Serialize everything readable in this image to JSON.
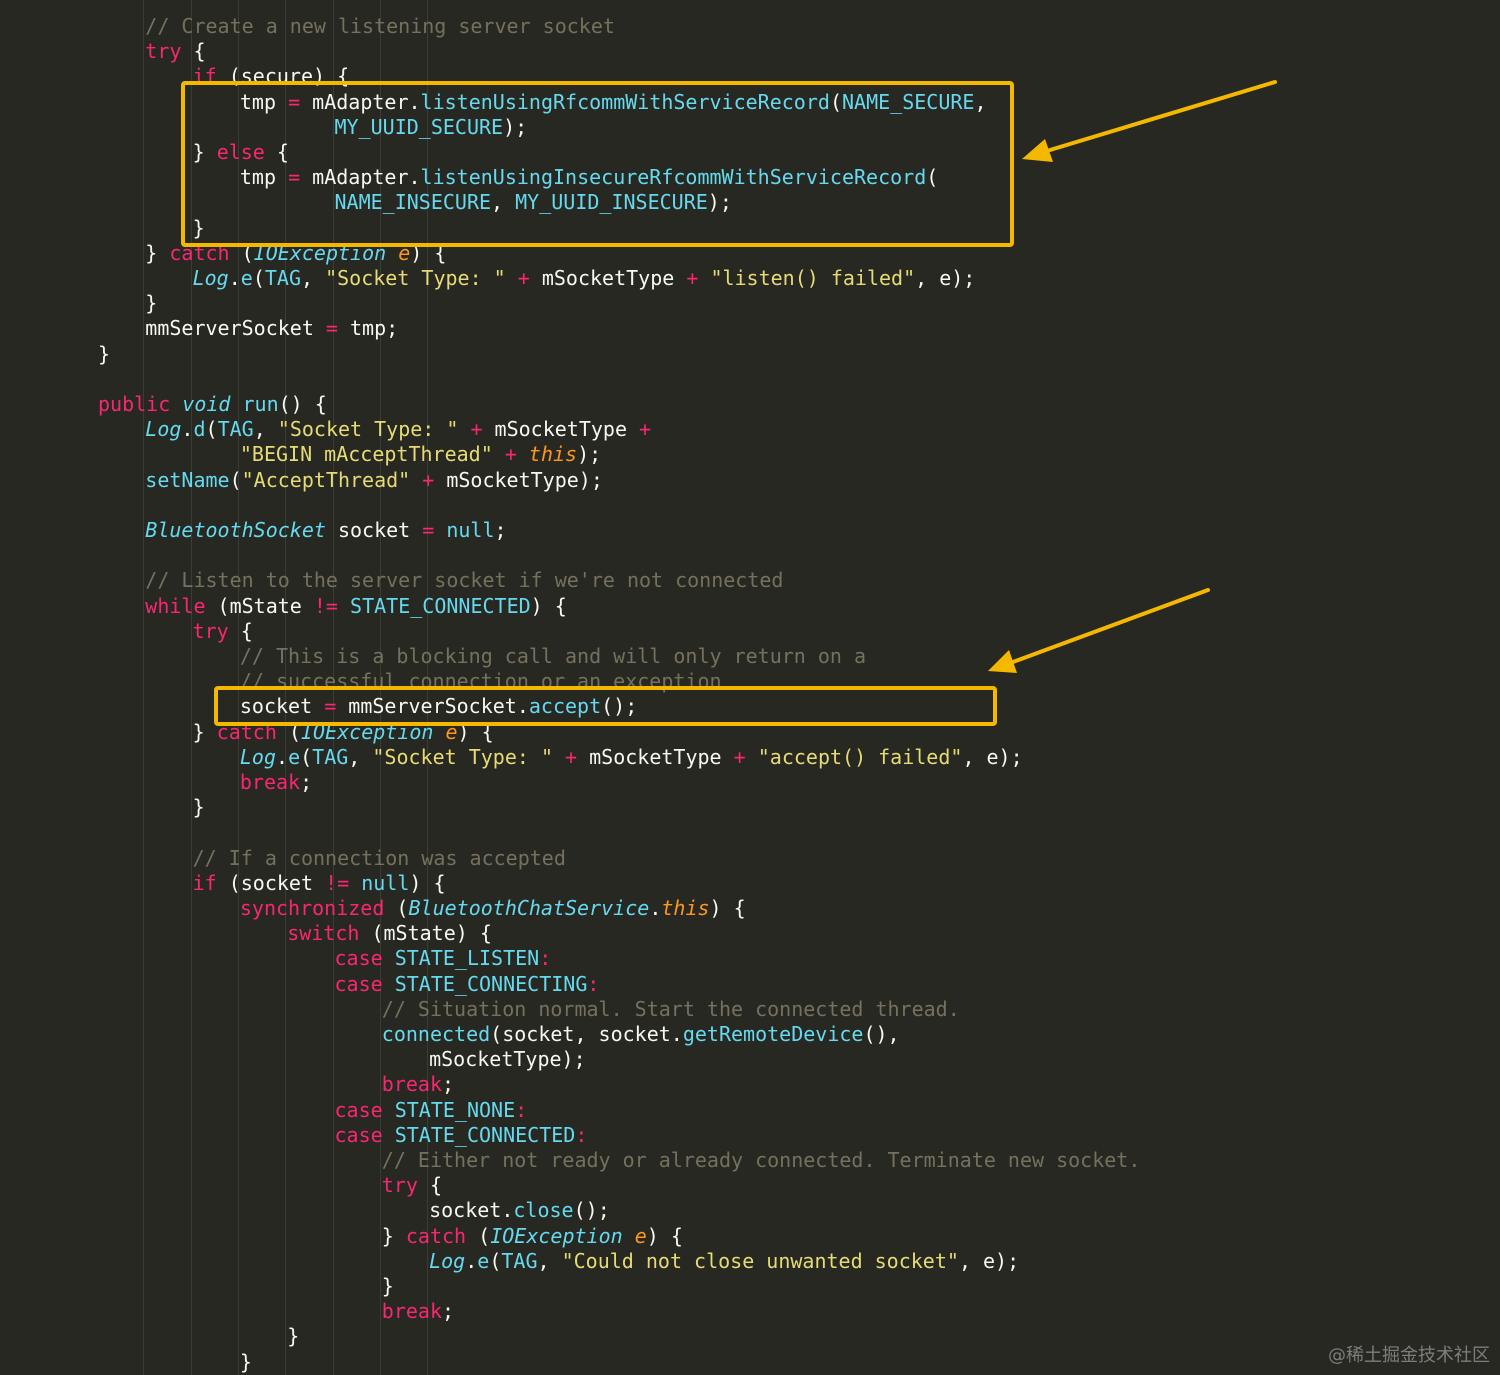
{
  "code_lines": [
    [
      [
        "cm",
        "// Create a new listening server socket"
      ]
    ],
    [
      [
        "kw",
        "try"
      ],
      [
        "p",
        " {"
      ]
    ],
    [
      [
        "kw",
        "if"
      ],
      [
        "p",
        " (secure) {"
      ]
    ],
    [
      [
        "p",
        "tmp "
      ],
      [
        "op",
        "="
      ],
      [
        "p",
        " mAdapter."
      ],
      [
        "fn",
        "listenUsingRfcommWithServiceRecord"
      ],
      [
        "p",
        "("
      ],
      [
        "cn",
        "NAME_SECURE"
      ],
      [
        "p",
        ","
      ]
    ],
    [
      [
        "cn",
        "MY_UUID_SECURE"
      ],
      [
        "p",
        ");"
      ]
    ],
    [
      [
        "p",
        "} "
      ],
      [
        "kw",
        "else"
      ],
      [
        "p",
        " {"
      ]
    ],
    [
      [
        "p",
        "tmp "
      ],
      [
        "op",
        "="
      ],
      [
        "p",
        " mAdapter."
      ],
      [
        "fn",
        "listenUsingInsecureRfcommWithServiceRecord"
      ],
      [
        "p",
        "("
      ]
    ],
    [
      [
        "cn",
        "NAME_INSECURE"
      ],
      [
        "p",
        ", "
      ],
      [
        "cn",
        "MY_UUID_INSECURE"
      ],
      [
        "p",
        ");"
      ]
    ],
    [
      [
        "p",
        "}"
      ]
    ],
    [
      [
        "p",
        "} "
      ],
      [
        "kw",
        "catch"
      ],
      [
        "p",
        " ("
      ],
      [
        "ty",
        "IOException"
      ],
      [
        "p",
        " "
      ],
      [
        "pa",
        "e"
      ],
      [
        "p",
        ") {"
      ]
    ],
    [
      [
        "ty",
        "Log"
      ],
      [
        "p",
        "."
      ],
      [
        "fn",
        "e"
      ],
      [
        "p",
        "("
      ],
      [
        "cn",
        "TAG"
      ],
      [
        "p",
        ", "
      ],
      [
        "st",
        "\"Socket Type: \""
      ],
      [
        "p",
        " "
      ],
      [
        "op",
        "+"
      ],
      [
        "p",
        " mSocketType "
      ],
      [
        "op",
        "+"
      ],
      [
        "p",
        " "
      ],
      [
        "st",
        "\"listen() failed\""
      ],
      [
        "p",
        ", e);"
      ]
    ],
    [
      [
        "p",
        "}"
      ]
    ],
    [
      [
        "p",
        "mmServerSocket "
      ],
      [
        "op",
        "="
      ],
      [
        "p",
        " tmp;"
      ]
    ],
    [
      [
        "p",
        "}"
      ]
    ],
    [],
    [
      [
        "kw",
        "public"
      ],
      [
        "p",
        " "
      ],
      [
        "ty",
        "void"
      ],
      [
        "p",
        " "
      ],
      [
        "fn",
        "run"
      ],
      [
        "p",
        "() {"
      ]
    ],
    [
      [
        "ty",
        "Log"
      ],
      [
        "p",
        "."
      ],
      [
        "fn",
        "d"
      ],
      [
        "p",
        "("
      ],
      [
        "cn",
        "TAG"
      ],
      [
        "p",
        ", "
      ],
      [
        "st",
        "\"Socket Type: \""
      ],
      [
        "p",
        " "
      ],
      [
        "op",
        "+"
      ],
      [
        "p",
        " mSocketType "
      ],
      [
        "op",
        "+"
      ]
    ],
    [
      [
        "st",
        "\"BEGIN mAcceptThread\""
      ],
      [
        "p",
        " "
      ],
      [
        "op",
        "+"
      ],
      [
        "p",
        " "
      ],
      [
        "th",
        "this"
      ],
      [
        "p",
        ");"
      ]
    ],
    [
      [
        "fn",
        "setName"
      ],
      [
        "p",
        "("
      ],
      [
        "st",
        "\"AcceptThread\""
      ],
      [
        "p",
        " "
      ],
      [
        "op",
        "+"
      ],
      [
        "p",
        " mSocketType);"
      ]
    ],
    [],
    [
      [
        "ty",
        "BluetoothSocket"
      ],
      [
        "p",
        " socket "
      ],
      [
        "op",
        "="
      ],
      [
        "p",
        " "
      ],
      [
        "cn",
        "null"
      ],
      [
        "p",
        ";"
      ]
    ],
    [],
    [
      [
        "cm",
        "// Listen to the server socket if we're not connected"
      ]
    ],
    [
      [
        "kw",
        "while"
      ],
      [
        "p",
        " (mState "
      ],
      [
        "op",
        "!="
      ],
      [
        "p",
        " "
      ],
      [
        "cn",
        "STATE_CONNECTED"
      ],
      [
        "p",
        ") {"
      ]
    ],
    [
      [
        "kw",
        "try"
      ],
      [
        "p",
        " {"
      ]
    ],
    [
      [
        "cm",
        "// This is a blocking call and will only return on a"
      ]
    ],
    [
      [
        "cm",
        "// successful connection or an exception"
      ]
    ],
    [
      [
        "p",
        "socket "
      ],
      [
        "op",
        "="
      ],
      [
        "p",
        " mmServerSocket."
      ],
      [
        "fn",
        "accept"
      ],
      [
        "p",
        "();"
      ]
    ],
    [
      [
        "p",
        "} "
      ],
      [
        "kw",
        "catch"
      ],
      [
        "p",
        " ("
      ],
      [
        "ty",
        "IOException"
      ],
      [
        "p",
        " "
      ],
      [
        "pa",
        "e"
      ],
      [
        "p",
        ") {"
      ]
    ],
    [
      [
        "ty",
        "Log"
      ],
      [
        "p",
        "."
      ],
      [
        "fn",
        "e"
      ],
      [
        "p",
        "("
      ],
      [
        "cn",
        "TAG"
      ],
      [
        "p",
        ", "
      ],
      [
        "st",
        "\"Socket Type: \""
      ],
      [
        "p",
        " "
      ],
      [
        "op",
        "+"
      ],
      [
        "p",
        " mSocketType "
      ],
      [
        "op",
        "+"
      ],
      [
        "p",
        " "
      ],
      [
        "st",
        "\"accept() failed\""
      ],
      [
        "p",
        ", e);"
      ]
    ],
    [
      [
        "kw",
        "break"
      ],
      [
        "p",
        ";"
      ]
    ],
    [
      [
        "p",
        "}"
      ]
    ],
    [],
    [
      [
        "cm",
        "// If a connection was accepted"
      ]
    ],
    [
      [
        "kw",
        "if"
      ],
      [
        "p",
        " (socket "
      ],
      [
        "op",
        "!="
      ],
      [
        "p",
        " "
      ],
      [
        "cn",
        "null"
      ],
      [
        "p",
        ") {"
      ]
    ],
    [
      [
        "kw",
        "synchronized"
      ],
      [
        "p",
        " ("
      ],
      [
        "ty",
        "BluetoothChatService"
      ],
      [
        "p",
        "."
      ],
      [
        "th",
        "this"
      ],
      [
        "p",
        ") {"
      ]
    ],
    [
      [
        "kw",
        "switch"
      ],
      [
        "p",
        " (mState) {"
      ]
    ],
    [
      [
        "kw",
        "case"
      ],
      [
        "p",
        " "
      ],
      [
        "cn",
        "STATE_LISTEN"
      ],
      [
        "op",
        ":"
      ]
    ],
    [
      [
        "kw",
        "case"
      ],
      [
        "p",
        " "
      ],
      [
        "cn",
        "STATE_CONNECTING"
      ],
      [
        "op",
        ":"
      ]
    ],
    [
      [
        "cm",
        "// Situation normal. Start the connected thread."
      ]
    ],
    [
      [
        "fn",
        "connected"
      ],
      [
        "p",
        "(socket, socket."
      ],
      [
        "fn",
        "getRemoteDevice"
      ],
      [
        "p",
        "(),"
      ]
    ],
    [
      [
        "p",
        "mSocketType);"
      ]
    ],
    [
      [
        "kw",
        "break"
      ],
      [
        "p",
        ";"
      ]
    ],
    [
      [
        "kw",
        "case"
      ],
      [
        "p",
        " "
      ],
      [
        "cn",
        "STATE_NONE"
      ],
      [
        "op",
        ":"
      ]
    ],
    [
      [
        "kw",
        "case"
      ],
      [
        "p",
        " "
      ],
      [
        "cn",
        "STATE_CONNECTED"
      ],
      [
        "op",
        ":"
      ]
    ],
    [
      [
        "cm",
        "// Either not ready or already connected. Terminate new socket."
      ]
    ],
    [
      [
        "kw",
        "try"
      ],
      [
        "p",
        " {"
      ]
    ],
    [
      [
        "p",
        "socket."
      ],
      [
        "fn",
        "close"
      ],
      [
        "p",
        "();"
      ]
    ],
    [
      [
        "p",
        "} "
      ],
      [
        "kw",
        "catch"
      ],
      [
        "p",
        " ("
      ],
      [
        "ty",
        "IOException"
      ],
      [
        "p",
        " "
      ],
      [
        "pa",
        "e"
      ],
      [
        "p",
        ") {"
      ]
    ],
    [
      [
        "ty",
        "Log"
      ],
      [
        "p",
        "."
      ],
      [
        "fn",
        "e"
      ],
      [
        "p",
        "("
      ],
      [
        "cn",
        "TAG"
      ],
      [
        "p",
        ", "
      ],
      [
        "st",
        "\"Could not close unwanted socket\""
      ],
      [
        "p",
        ", e);"
      ]
    ],
    [
      [
        "p",
        "}"
      ]
    ],
    [
      [
        "kw",
        "break"
      ],
      [
        "p",
        ";"
      ]
    ],
    [
      [
        "p",
        "}"
      ]
    ],
    [
      [
        "p",
        "}"
      ]
    ]
  ],
  "highlight_boxes": [
    "secure-socket-branch",
    "accept-call"
  ],
  "annotation_color": "#f5b800",
  "watermark": "@稀土掘金技术社区"
}
